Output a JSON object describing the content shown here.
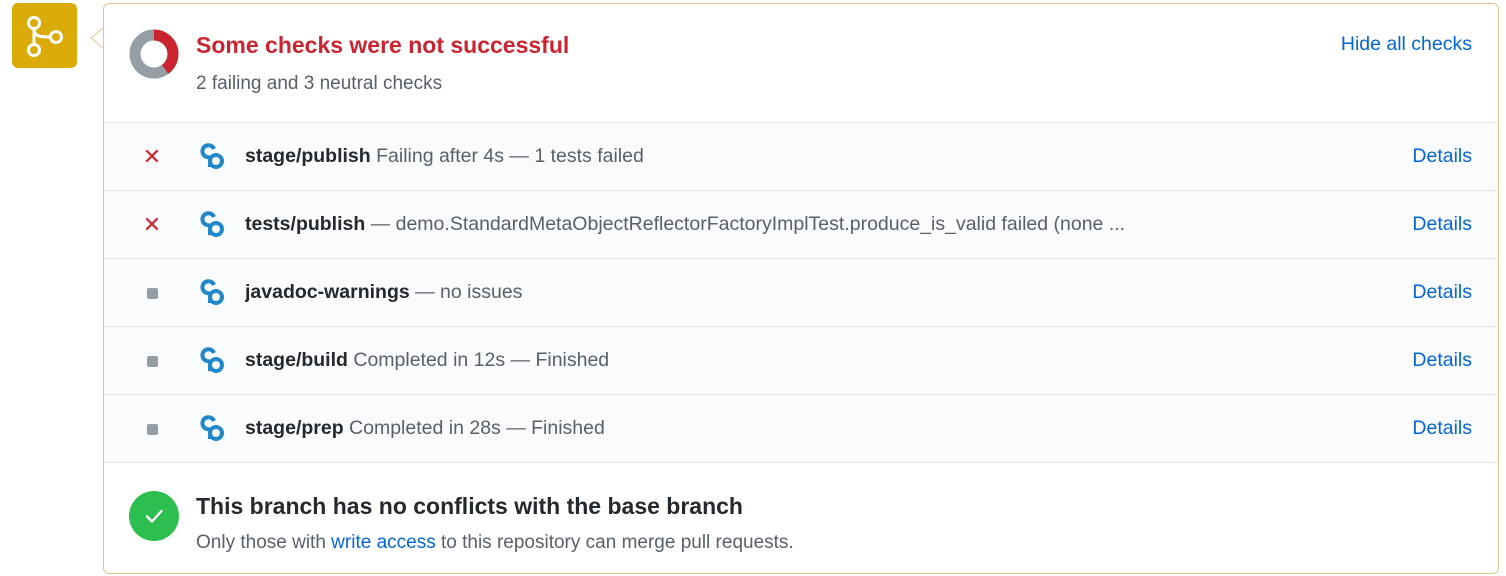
{
  "header": {
    "title": "Some checks were not successful",
    "summary": "2 failing and 3 neutral checks",
    "hide_label": "Hide all checks"
  },
  "status_colors": {
    "failing": "#cb2431",
    "neutral": "#959da5",
    "success": "#2cbe4e",
    "warning_badge": "#dbab09",
    "link": "#0366d6"
  },
  "checks": [
    {
      "status": "failing",
      "status_icon": "x-icon",
      "name": "stage/publish",
      "description": "  Failing after 4s — 1 tests failed",
      "details_label": "Details"
    },
    {
      "status": "failing",
      "status_icon": "x-icon",
      "name": "tests/publish",
      "description": " — demo.StandardMetaObjectReflectorFactoryImplTest.produce_is_valid failed (none ...",
      "details_label": "Details"
    },
    {
      "status": "neutral",
      "status_icon": "square-icon",
      "name": "javadoc-warnings",
      "description": " — no issues",
      "details_label": "Details"
    },
    {
      "status": "neutral",
      "status_icon": "square-icon",
      "name": "stage/build",
      "description": "  Completed in 12s — Finished",
      "details_label": "Details"
    },
    {
      "status": "neutral",
      "status_icon": "square-icon",
      "name": "stage/prep",
      "description": "  Completed in 28s — Finished",
      "details_label": "Details"
    }
  ],
  "merge": {
    "title": "This branch has no conflicts with the base branch",
    "sub_prefix": "Only those with ",
    "sub_link": "write access",
    "sub_suffix": " to this repository can merge pull requests."
  }
}
